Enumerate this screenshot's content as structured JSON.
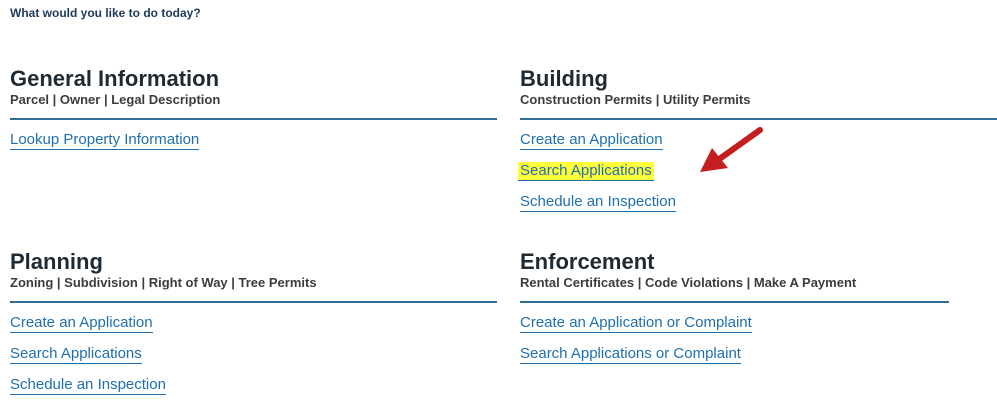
{
  "prompt": "What would you like to do today?",
  "sections": {
    "general": {
      "title": "General Information",
      "subtitle": "Parcel | Owner | Legal Description",
      "links": [
        "Lookup Property Information"
      ]
    },
    "building": {
      "title": "Building",
      "subtitle": "Construction Permits | Utility Permits",
      "links": [
        "Create an Application",
        "Search Applications",
        "Schedule an Inspection"
      ]
    },
    "planning": {
      "title": "Planning",
      "subtitle": "Zoning | Subdivision | Right of Way | Tree Permits",
      "links": [
        "Create an Application",
        "Search Applications",
        "Schedule an Inspection"
      ]
    },
    "enforcement": {
      "title": "Enforcement",
      "subtitle": "Rental Certificates | Code Violations | Make A Payment",
      "links": [
        "Create an Application or Complaint",
        "Search Applications or Complaint"
      ]
    }
  },
  "annotation": {
    "arrow_color": "#c41e1e",
    "highlight_color": "#ffff3a",
    "icon": "red-arrow-icon"
  }
}
